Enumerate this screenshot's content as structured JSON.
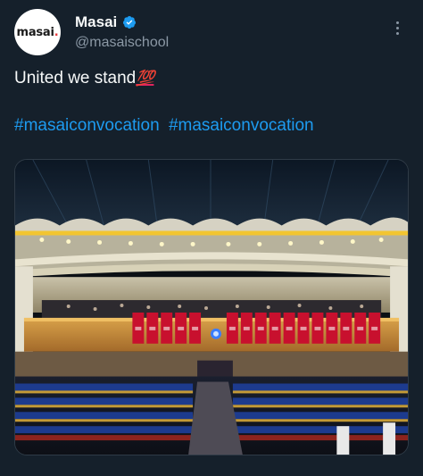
{
  "account": {
    "avatar_logo": "masai.",
    "display_name": "Masai",
    "verified": true,
    "handle": "@masaischool"
  },
  "icons": {
    "verified": "verified-badge-icon",
    "more": "more-options-icon"
  },
  "tweet": {
    "text": "United we stand",
    "emoji": "💯",
    "hashtags": [
      "#masaiconvocation",
      "#masaiconvocation"
    ]
  },
  "media": {
    "description_type": "photo",
    "subject": "convocation-auditorium"
  },
  "colors": {
    "background": "#15202b",
    "link": "#1d9bf0",
    "secondary_text": "#8b98a5",
    "verified": "#1d9bf0",
    "banner_red": "#c8102e"
  }
}
